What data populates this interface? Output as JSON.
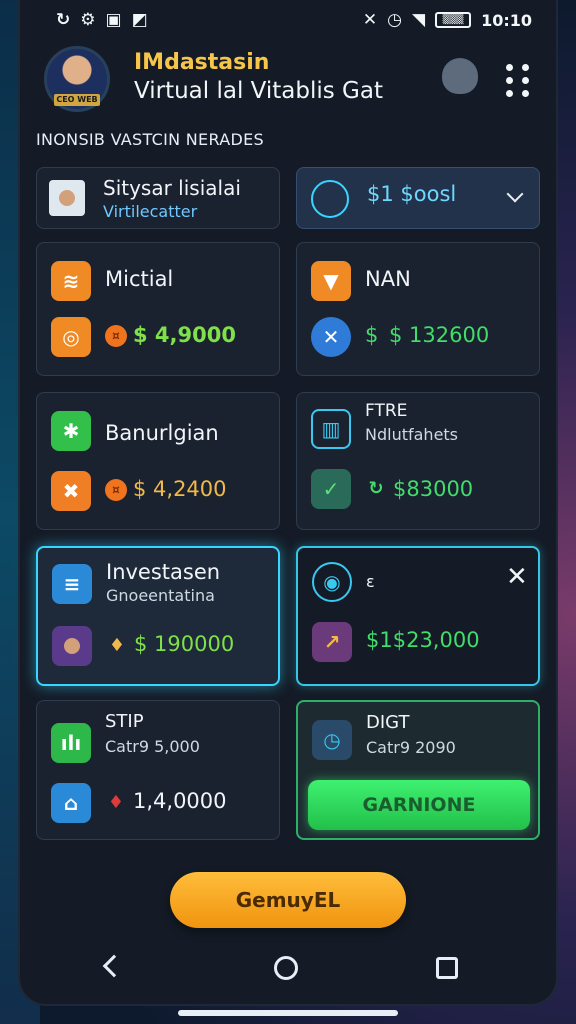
{
  "status_bar": {
    "left_icons": [
      "sync-icon",
      "settings-icon",
      "gallery-icon",
      "image-icon"
    ],
    "time": "10:10",
    "battery": "▒▒▒"
  },
  "header": {
    "avatar_tag": "CEO WEB",
    "title": "IMdastasin",
    "subtitle": "Virtual lal Vitablis Gat"
  },
  "section_label": "INONSIB VASTCIN NERADES",
  "profile": {
    "name": "Sitysar lisialai",
    "role": "Virtilecatter"
  },
  "selector": {
    "value": "$1 $oosl"
  },
  "cards": [
    {
      "title": "Mictial",
      "value": "$ 4,9000"
    },
    {
      "title": "NAN",
      "value": "$ 132600"
    },
    {
      "title": "Banurlgian",
      "value": "$ 4,2400"
    },
    {
      "title": "FTRE",
      "subtitle": "Ndlutfahets",
      "value": "$83000"
    },
    {
      "title": "Investasen",
      "subtitle": "Gnoeentatina",
      "value": "$ 190000"
    },
    {
      "title": "ε",
      "value": "$1$23,000"
    },
    {
      "title": "STIP",
      "subtitle": "Catr9 5,000",
      "value": "1,4,0000"
    },
    {
      "title": "DIGT",
      "subtitle": "Catr9 2090",
      "button": "GARNIONE"
    }
  ],
  "main_button": "GemuyEL",
  "colors": {
    "accent_orange": "#f09410",
    "accent_green": "#22c04a",
    "accent_cyan": "#39d4ff",
    "title_gold": "#f5c64a"
  }
}
